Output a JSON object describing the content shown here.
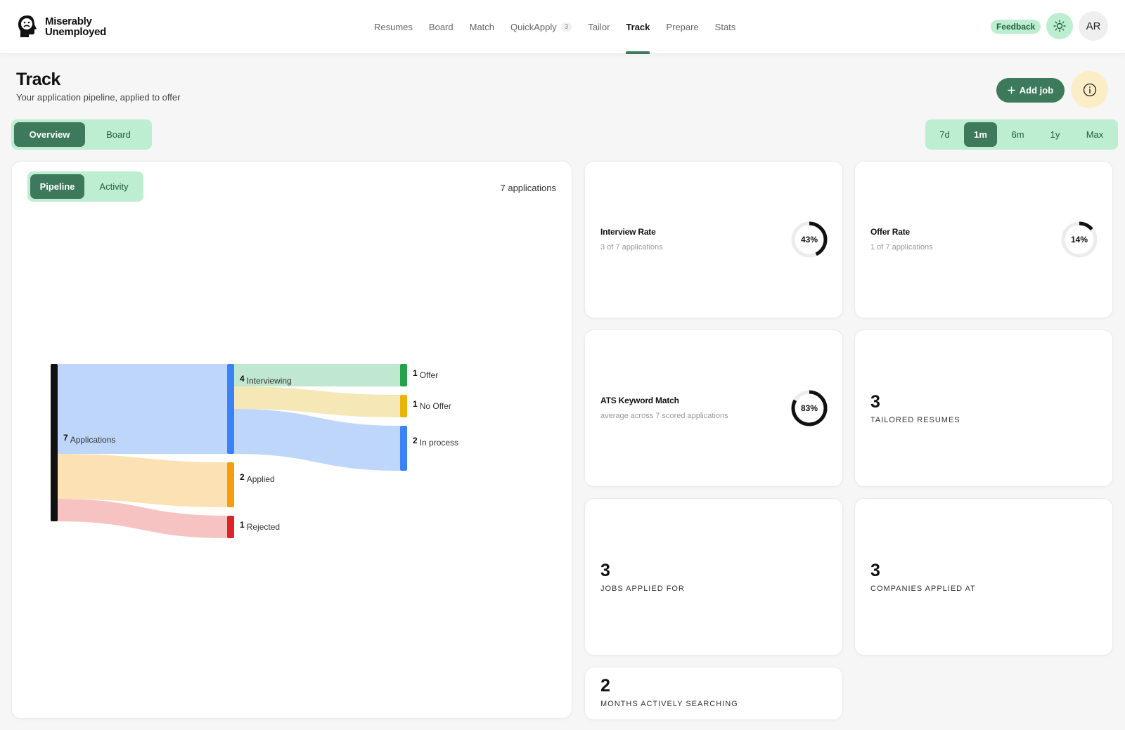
{
  "app": {
    "name_line1": "Miserably",
    "name_line2": "Unemployed"
  },
  "nav": [
    {
      "label": "Resumes"
    },
    {
      "label": "Board"
    },
    {
      "label": "Match"
    },
    {
      "label": "QuickApply",
      "badge": "3"
    },
    {
      "label": "Tailor"
    },
    {
      "label": "Track",
      "active": true
    },
    {
      "label": "Prepare"
    },
    {
      "label": "Stats"
    }
  ],
  "header": {
    "feedback_label": "Feedback",
    "theme_icon": "sun-icon",
    "avatar_initials": "AR"
  },
  "page": {
    "title": "Track",
    "subtitle": "Your application pipeline, applied to offer",
    "add_job_label": "Add job",
    "info_icon": "info-icon"
  },
  "view_tabs": [
    {
      "label": "Overview",
      "active": true
    },
    {
      "label": "Board"
    }
  ],
  "range_tabs": [
    {
      "label": "7d"
    },
    {
      "label": "1m",
      "active": true
    },
    {
      "label": "6m"
    },
    {
      "label": "1y"
    },
    {
      "label": "Max"
    }
  ],
  "chart_tabs": [
    {
      "label": "Pipeline",
      "active": true
    },
    {
      "label": "Activity"
    }
  ],
  "applications_count": "7 applications",
  "chart_data": {
    "type": "sankey",
    "nodes": [
      {
        "id": "applications",
        "label": "Applications",
        "value": 7,
        "color": "#111111"
      },
      {
        "id": "interviewing",
        "label": "Interviewing",
        "value": 4,
        "color": "#3b82f6"
      },
      {
        "id": "applied",
        "label": "Applied",
        "value": 2,
        "color": "#f59e0b"
      },
      {
        "id": "rejected",
        "label": "Rejected",
        "value": 1,
        "color": "#dc2626"
      },
      {
        "id": "offer",
        "label": "Offer",
        "value": 1,
        "color": "#22a34a"
      },
      {
        "id": "no_offer",
        "label": "No Offer",
        "value": 1,
        "color": "#eab308"
      },
      {
        "id": "in_process",
        "label": "In process",
        "value": 2,
        "color": "#3b82f6"
      }
    ],
    "links": [
      {
        "source": "applications",
        "target": "interviewing",
        "value": 4,
        "color": "#bcd4fb"
      },
      {
        "source": "applications",
        "target": "applied",
        "value": 2,
        "color": "#fbdfb0"
      },
      {
        "source": "applications",
        "target": "rejected",
        "value": 1,
        "color": "#f6bfbf"
      },
      {
        "source": "interviewing",
        "target": "offer",
        "value": 1,
        "color": "#bde6cc"
      },
      {
        "source": "interviewing",
        "target": "no_offer",
        "value": 1,
        "color": "#f6e6b2"
      },
      {
        "source": "interviewing",
        "target": "in_process",
        "value": 2,
        "color": "#bcd4fb"
      }
    ]
  },
  "metrics": {
    "interview_rate": {
      "title": "Interview Rate",
      "sub": "3 of 7 applications",
      "percent": 43,
      "label": "43%"
    },
    "offer_rate": {
      "title": "Offer Rate",
      "sub": "1 of 7 applications",
      "percent": 14,
      "label": "14%"
    },
    "ats_match": {
      "title": "ATS Keyword Match",
      "sub": "average across 7 scored applications",
      "percent": 83,
      "label": "83%"
    }
  },
  "stats": {
    "tailored_resumes": {
      "value": "3",
      "label": "TAILORED RESUMES"
    },
    "jobs_applied": {
      "value": "3",
      "label": "JOBS APPLIED FOR"
    },
    "companies_applied": {
      "value": "3",
      "label": "COMPANIES APPLIED AT"
    },
    "months_searching": {
      "value": "2",
      "label": "MONTHS ACTIVELY SEARCHING"
    }
  }
}
